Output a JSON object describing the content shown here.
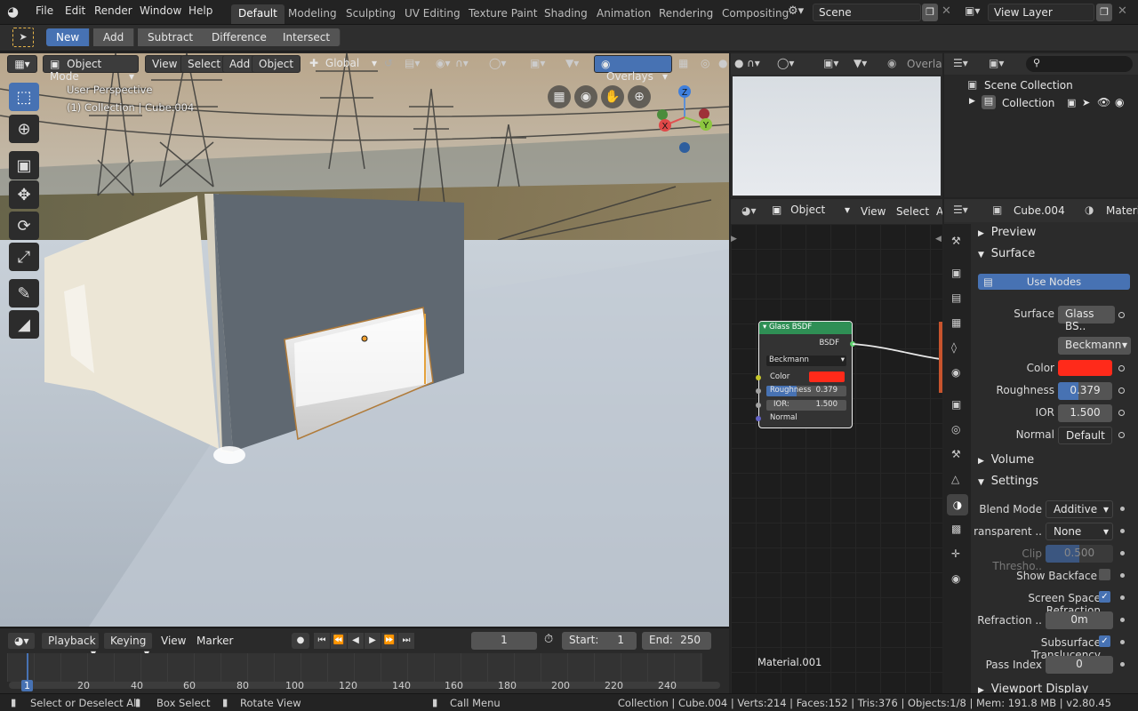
{
  "topbar": {
    "menus": [
      "File",
      "Edit",
      "Render",
      "Window",
      "Help"
    ],
    "workspaces": [
      "Default",
      "Modeling",
      "Sculpting",
      "UV Editing",
      "Texture Paint",
      "Shading",
      "Animation",
      "Rendering",
      "Compositing"
    ],
    "active_workspace": "Default",
    "scene": "Scene",
    "view_layer": "View Layer"
  },
  "toolsettings": {
    "modes": [
      "New",
      "Add",
      "Subtract",
      "Difference",
      "Intersect"
    ],
    "active_mode": "New"
  },
  "viewport": {
    "mode": "Object Mode",
    "menus": [
      "View",
      "Select",
      "Add",
      "Object"
    ],
    "transform": "Global",
    "overlays": "Overlays",
    "info_line1": "User Perspective",
    "info_line2": "(1) Collection | Cube.004",
    "gizmo": {
      "z": "Z",
      "y": "Y",
      "x": "X"
    }
  },
  "timeline": {
    "menus": [
      "Playback",
      "Keying",
      "View",
      "Marker"
    ],
    "current_frame": "1",
    "start_label": "Start:",
    "start": "1",
    "end_label": "End:",
    "end": "250",
    "ticks": [
      "1",
      "20",
      "40",
      "60",
      "80",
      "100",
      "120",
      "140",
      "160",
      "180",
      "200",
      "220",
      "240"
    ]
  },
  "node_editor": {
    "type": "Object",
    "menus": [
      "View",
      "Select"
    ],
    "extra": "A",
    "material_name": "Material.001",
    "node": {
      "title": "Glass BSDF",
      "output": "BSDF",
      "distribution": "Beckmann",
      "color_label": "Color",
      "roughness_label": "Roughness",
      "roughness": "0.379",
      "ior_label": "IOR:",
      "ior": "1.500",
      "normal_label": "Normal"
    }
  },
  "preview_window": {
    "overlay": "Overlay"
  },
  "outliner": {
    "root": "Scene Collection",
    "child": "Collection"
  },
  "properties": {
    "object": "Cube.004",
    "material_tab": "Materia",
    "sections": {
      "preview": "Preview",
      "surface": "Surface",
      "volume": "Volume",
      "settings": "Settings",
      "viewport": "Viewport Display"
    },
    "use_nodes": "Use Nodes",
    "surface_label": "Surface",
    "surface_value": "Glass BS..",
    "distribution": "Beckmann",
    "color_label": "Color",
    "color_hex": "#ff2a1a",
    "roughness_label": "Roughness",
    "roughness": "0.379",
    "roughness_fraction": 0.379,
    "ior_label": "IOR",
    "ior": "1.500",
    "normal_label": "Normal",
    "normal": "Default",
    "blend_mode_label": "Blend Mode",
    "blend_mode": "Additive",
    "shadow_label": "ransparent ..",
    "shadow": "None",
    "clip_label": "Clip Thresho..",
    "clip": "0.500",
    "backface_label": "Show Backface",
    "ssr_label": "Screen Space Refraction",
    "refraction_label": "Refraction ..",
    "refraction": "0m",
    "subsurface_label": "Subsurface Translucency",
    "pass_label": "Pass Index",
    "pass": "0"
  },
  "statusbar": {
    "select": "Select or Deselect All",
    "box": "Box Select",
    "rotate": "Rotate View",
    "call": "Call Menu",
    "stats": "Collection | Cube.004 | Verts:214 | Faces:152 | Tris:376 | Objects:1/8 | Mem: 191.8 MB | v2.80.45"
  },
  "colors": {
    "accent": "#4772b3",
    "node_header": "#2f8f55",
    "bsdf_color": "#ff2a1a"
  }
}
